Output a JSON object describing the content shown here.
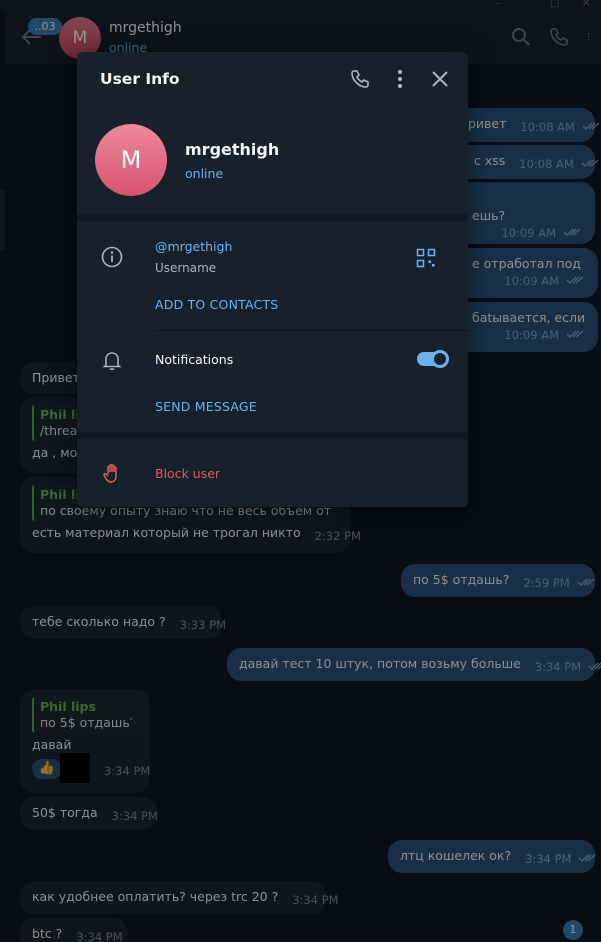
{
  "window": {
    "controls": [
      "–",
      "□",
      "✕"
    ]
  },
  "header": {
    "unread_count": "..03",
    "avatar_letter": "M",
    "name": "mrgethigh",
    "status": "online"
  },
  "messages": {
    "out_1": {
      "text": "ривет",
      "time": "10:08 AM"
    },
    "out_2": {
      "text": "с xss",
      "time": "10:08 AM"
    },
    "out_3": {
      "text": "ешь?",
      "time": "10:09 AM"
    },
    "out_4": {
      "text": "е отработал под",
      "time": "10:09 AM"
    },
    "out_5": {
      "text": "бatывается, если",
      "time": "10:09 AM"
    },
    "in_1": {
      "text": "Привет"
    },
    "in_2": {
      "quote_name": "Phil li",
      "quote_text": "/threa",
      "text": "да , мог"
    },
    "in_3": {
      "quote_name": "Phil li",
      "quote_text": "по своему опыту знаю что не весь объем от...",
      "text": "есть материал который не трогал никто",
      "time": "2:32 PM"
    },
    "out_6": {
      "text": "по 5$ отдашь?",
      "time": "2:59 PM"
    },
    "in_4": {
      "text": "тебе сколько надо ?",
      "time": "3:33 PM"
    },
    "out_7": {
      "text": "давай тест 10 штук, потом возьму больше",
      "time": "3:34 PM"
    },
    "in_5": {
      "quote_name": "Phil lips",
      "quote_text": "по 5$ отдашь?",
      "text": "давай",
      "reaction": "👍",
      "time": "3:34 PM"
    },
    "in_6": {
      "text": "50$ тогда",
      "time": "3:34 PM"
    },
    "out_8": {
      "text": "лтц кошелек ок?",
      "time": "3:34 PM"
    },
    "in_7": {
      "text": "как удобнее оплатить? через trc 20 ?",
      "time": "3:34 PM"
    },
    "in_8": {
      "text": "btc ?",
      "time": "3:34 PM"
    },
    "unread_badge": "1"
  },
  "dialog": {
    "title": "User Info",
    "avatar_letter": "M",
    "name": "mrgethigh",
    "status": "online",
    "username": "@mrgethigh",
    "username_label": "Username",
    "add_contacts": "ADD TO CONTACTS",
    "notifications_label": "Notifications",
    "notifications_on": true,
    "send_message": "SEND MESSAGE",
    "block_user": "Block user"
  },
  "colors": {
    "accent": "#6ab3f3",
    "danger": "#e6585e",
    "bubble_out": "#2b5278",
    "bubble_in": "#182533",
    "panel": "#17212b",
    "background": "#0e1621"
  }
}
